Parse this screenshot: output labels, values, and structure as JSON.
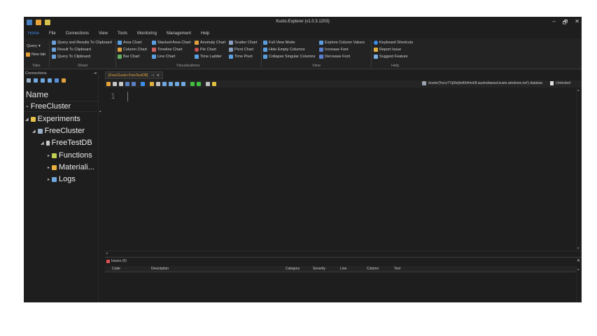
{
  "window": {
    "title": "Kusto.Explorer (v1.0.3.1203)",
    "controls": [
      "–",
      "🗗",
      "✕"
    ]
  },
  "menu": {
    "items": [
      "Home",
      "File",
      "Connections",
      "View",
      "Tools",
      "Monitoring",
      "Management",
      "Help"
    ]
  },
  "ribbon": {
    "query_label": "Query",
    "new_tab_label": "New tab",
    "tabs_group": "Tabs",
    "share": {
      "group": "Share",
      "items": [
        "Query and Results To Clipboard",
        "Result To Clipboard",
        "Query To Clipboard"
      ]
    },
    "visualizations": {
      "group": "Visualizations",
      "col1": [
        "Area Chart",
        "Column Chart",
        "Bar Chart"
      ],
      "col2": [
        "Stacked Area Chart",
        "Timeline Chart",
        "Line Chart"
      ],
      "col3": [
        "Anomaly Chart",
        "Pie Chart",
        "Time Ladder"
      ],
      "col4": [
        "Scatter Chart",
        "Pivot Chart",
        "Time Pivot"
      ]
    },
    "view": {
      "group": "View",
      "col1": [
        "Full View Mode",
        "Hide Empty Columns",
        "Collapse Singular Columns"
      ],
      "col2": [
        "Explore Column Values",
        "Increase Font",
        "Decrease Font"
      ]
    },
    "help": {
      "group": "Help",
      "items": [
        "Keyboard Shortcuts",
        "Report Issue",
        "Suggest Feature"
      ]
    },
    "colors": {
      "accent": "#3d8ee8"
    }
  },
  "connections": {
    "header": "Connections",
    "pin": "⇥",
    "name_header": "Name",
    "selected": "FreeCluster",
    "tree": [
      {
        "label": "Experiments"
      },
      {
        "label": "FreeCluster"
      },
      {
        "label": "FreeTestDB"
      },
      {
        "label": "Functions"
      },
      {
        "label": "Materiali..."
      },
      {
        "label": "Logs"
      }
    ]
  },
  "editor": {
    "tab_name": "[FreeCluster.FreeTestDB]",
    "tab_pin": "⊣",
    "tab_close": "✕",
    "cluster_uri": "cluster('kvcz77q5tnjfxd0efmxh8.australiaeast.kusto.windows.net').databas",
    "lock_state": "Unlocked",
    "line_number": "1"
  },
  "issues": {
    "title": "Issues (0)",
    "close": "✕",
    "columns": [
      "Code",
      "Description",
      "Category",
      "Severity",
      "Line",
      "Column",
      "Text"
    ]
  }
}
